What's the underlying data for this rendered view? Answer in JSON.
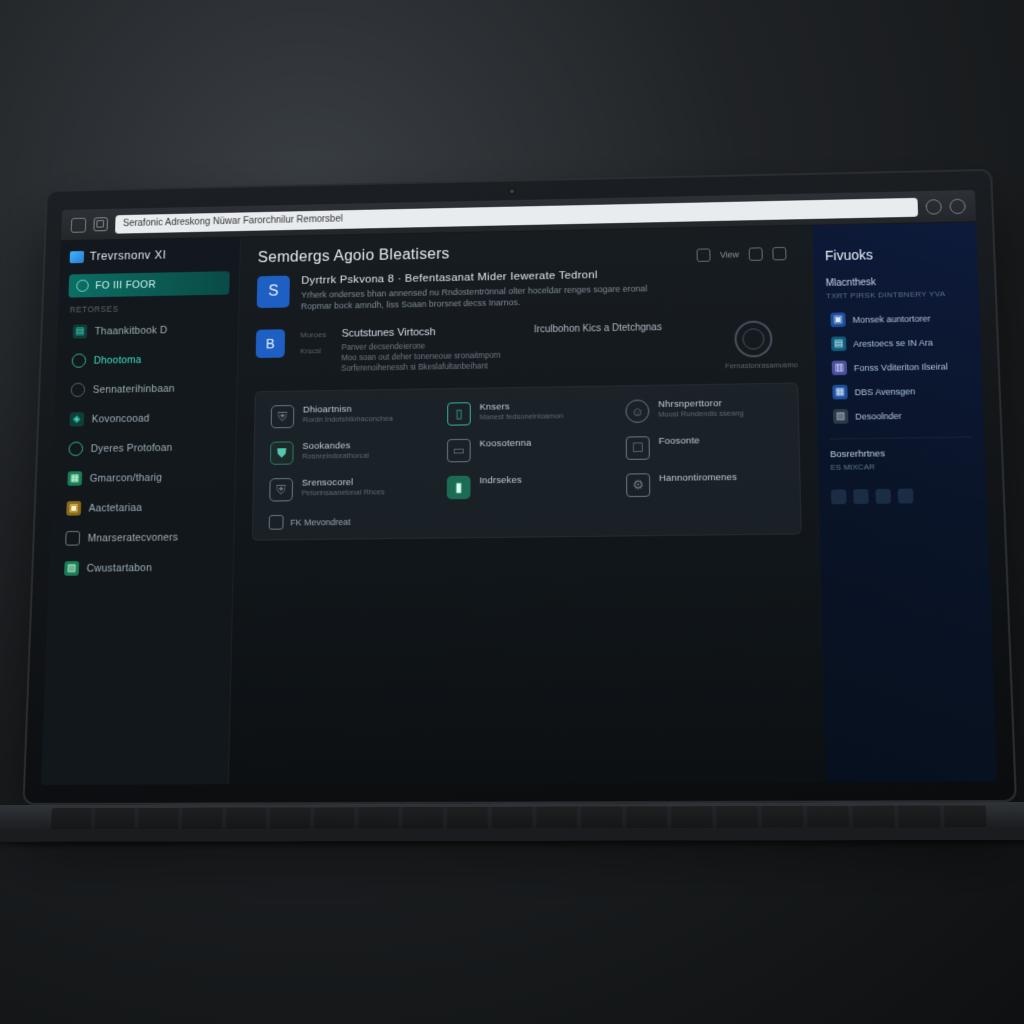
{
  "address_bar": {
    "value": "Serafonic Adreskong Nüwar Farorchnilur Remorsbel"
  },
  "sidebar": {
    "title": "Trevrsnonv XI",
    "active_label": "FO III  FOOR",
    "section_label": "Retorses",
    "items": [
      {
        "label": "Thaankitbook D"
      },
      {
        "label": "Dhootoma"
      },
      {
        "label": "Sennaterihinbaan"
      },
      {
        "label": "Kovoncooad"
      },
      {
        "label": "Dyeres Protofoan"
      },
      {
        "label": "Gmarcon/tharig"
      },
      {
        "label": "Aactetariaa"
      },
      {
        "label": "Mnarseratecvoners"
      },
      {
        "label": "Cwustartabon"
      }
    ]
  },
  "main": {
    "heading": "Semdergs Agoio Bleatisers",
    "toolbar_label": "View",
    "banner": {
      "badge_glyph": "S",
      "title": "Dyrtrrk Pskvona 8 · Befentasanat Mider Iewerate Tedronl",
      "line1": "Yrherk onderses bhan annensed nu Rndostentrönnal olter hoceldar renges sogare eronal",
      "line2": "Ropmar bock amndh, liss Soaan brorsnet decss Inarnos."
    },
    "mid": {
      "badge_glyph": "B",
      "col_label1": "Moroes",
      "col_label2": "Krscsl",
      "title": "Scutstunes Virtocsh",
      "subtitle": "Irculbohon Kics a Dtetchgnas",
      "line1": "Panver decsendeierone",
      "line2": "Moo soan out deher toneneoue sronaitmporn",
      "line3": "Sorferenoihenessh si Bkeslafultanbeihant",
      "scan_sub": "Fernastonrasamusmo"
    },
    "tiles": {
      "row1": [
        {
          "title": "Dhioartnisn",
          "sub": "Rordn Indotshilohaconchea"
        },
        {
          "title": "Knsers",
          "sub": "Manest fedsonelnloamon"
        },
        {
          "title": "Nhrsnperttoror",
          "sub": "Moost Rundendis sseang"
        }
      ],
      "row2": [
        {
          "title": "Sookandes",
          "sub": "Rosnreindorathorcal"
        },
        {
          "title": "Koosotenna",
          "sub": ""
        },
        {
          "title": "Foosonte",
          "sub": ""
        }
      ],
      "row3": [
        {
          "title": "Srensocorel",
          "sub": "Petorinsaanetonal Rhces"
        },
        {
          "title": "Indrsekes",
          "sub": ""
        },
        {
          "title": "Hannontiromenes",
          "sub": ""
        }
      ],
      "footer_label": "FK Mevondreat"
    }
  },
  "rail": {
    "title": "Fivuoks",
    "section_label": "Mlacnthesk",
    "section_sub": "TXRT PIRSK DINTBNERY YVA",
    "items": [
      {
        "label": "Monsek auntortorer"
      },
      {
        "label": "Arestoecs se IN Ara"
      },
      {
        "label": "Fonss Vditeriton Ilseiral"
      },
      {
        "label": "DBS Avensgen"
      },
      {
        "label": "Desoolnder"
      }
    ],
    "footer_label": "Bosrerhrtnes",
    "footer_sub": "ES MIXCAR"
  }
}
